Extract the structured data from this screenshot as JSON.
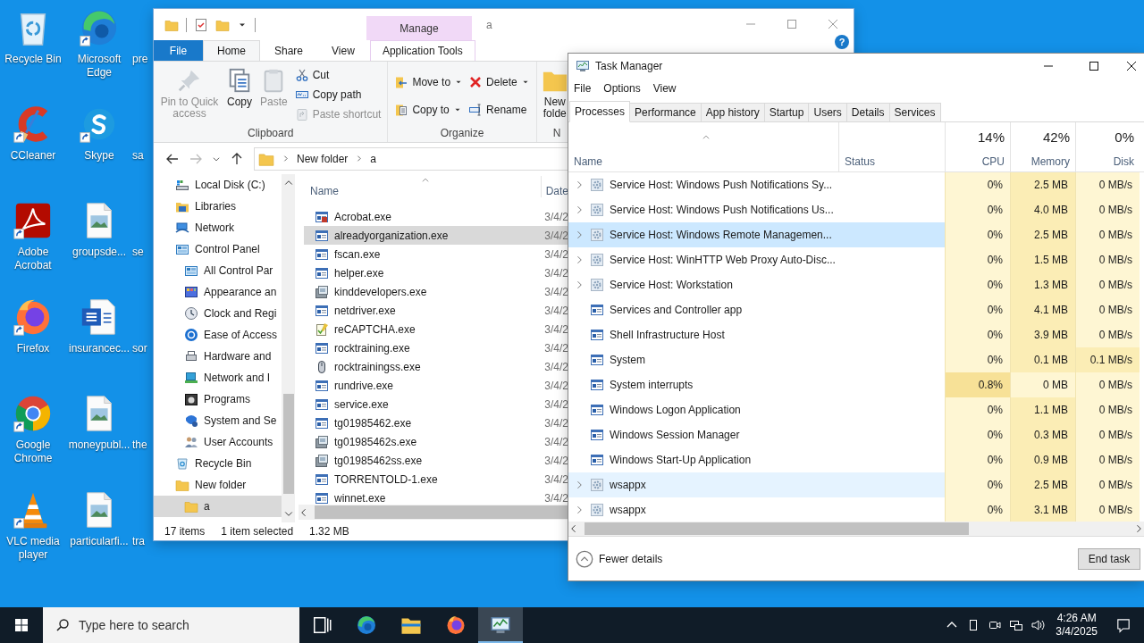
{
  "desktop": {
    "icons": [
      {
        "label": "Recycle Bin",
        "kind": "recycle",
        "shortcut": false
      },
      {
        "label": "Microsoft Edge",
        "kind": "edge",
        "shortcut": true
      },
      {
        "label": "pre",
        "kind": "partial"
      },
      {
        "label": "CCleaner",
        "kind": "ccleaner",
        "shortcut": true
      },
      {
        "label": "Skype",
        "kind": "skype",
        "shortcut": true
      },
      {
        "label": "sa",
        "kind": "partial"
      },
      {
        "label": "Adobe Acrobat",
        "kind": "acrobat",
        "shortcut": true
      },
      {
        "label": "groupsde...",
        "kind": "image",
        "shortcut": false
      },
      {
        "label": "se",
        "kind": "partial"
      },
      {
        "label": "Firefox",
        "kind": "firefox",
        "shortcut": true
      },
      {
        "label": "insurancec...",
        "kind": "word",
        "shortcut": false
      },
      {
        "label": "sor",
        "kind": "partial"
      },
      {
        "label": "Google Chrome",
        "kind": "chrome",
        "shortcut": true
      },
      {
        "label": "moneypubl...",
        "kind": "image",
        "shortcut": false
      },
      {
        "label": "the",
        "kind": "partial"
      },
      {
        "label": "VLC media player",
        "kind": "vlc",
        "shortcut": true
      },
      {
        "label": "particularfi...",
        "kind": "image",
        "shortcut": false
      },
      {
        "label": "tra",
        "kind": "partial"
      }
    ]
  },
  "explorer": {
    "title": "a",
    "context_header": "Manage",
    "help": "?",
    "tabs": [
      {
        "label": "File",
        "kind": "file",
        "selected": false
      },
      {
        "label": "Home",
        "kind": "plain",
        "selected": true
      },
      {
        "label": "Share",
        "kind": "plain",
        "selected": false
      },
      {
        "label": "View",
        "kind": "plain",
        "selected": false
      },
      {
        "label": "Application Tools",
        "kind": "context",
        "selected": false
      }
    ],
    "ribbon": [
      {
        "label": "Clipboard",
        "columns": [
          [
            {
              "label": "Pin to Quick access",
              "kind": "pin",
              "disabled": true
            }
          ],
          [
            {
              "label": "Copy",
              "kind": "copy",
              "disabled": false
            }
          ],
          [
            {
              "label": "Paste",
              "kind": "paste",
              "disabled": true
            }
          ],
          [
            {
              "label": "Cut",
              "kind": "cut",
              "disabled": false
            },
            {
              "label": "Copy path",
              "kind": "path",
              "disabled": false
            },
            {
              "label": "Paste shortcut",
              "kind": "shortcut",
              "disabled": true
            }
          ]
        ]
      },
      {
        "label": "Organize",
        "columns": [
          [
            {
              "label": "Move to",
              "kind": "move",
              "disabled": false,
              "dropdown": true
            },
            {
              "label": "Copy to",
              "kind": "copyto",
              "disabled": false,
              "dropdown": true
            }
          ],
          [
            {
              "label": "Delete",
              "kind": "delete",
              "disabled": false,
              "dropdown": true
            },
            {
              "label": "Rename",
              "kind": "rename",
              "disabled": false,
              "dropdown": false
            }
          ]
        ]
      },
      {
        "label": "N",
        "columns": [
          [
            {
              "label": "New folde",
              "kind": "newfolder",
              "disabled": false
            }
          ]
        ]
      }
    ],
    "address": {
      "crumbs": [
        "New folder",
        "a"
      ]
    },
    "nav": [
      {
        "label": "Local Disk (C:)",
        "kind": "drive",
        "selected": false
      },
      {
        "label": "Libraries",
        "kind": "library",
        "selected": false
      },
      {
        "label": "Network",
        "kind": "network",
        "selected": false
      },
      {
        "label": "Control Panel",
        "kind": "panel",
        "selected": false,
        "children": [
          {
            "label": "All Control Par",
            "kind": "panel",
            "selected": false
          },
          {
            "label": "Appearance an",
            "kind": "appearance",
            "selected": false
          },
          {
            "label": "Clock and Regi",
            "kind": "clock",
            "selected": false
          },
          {
            "label": "Ease of Access",
            "kind": "ease",
            "selected": false
          },
          {
            "label": "Hardware and",
            "kind": "hardware",
            "selected": false
          },
          {
            "label": "Network and I",
            "kind": "netcenter",
            "selected": false
          },
          {
            "label": "Programs",
            "kind": "programs",
            "selected": false
          },
          {
            "label": "System and Se",
            "kind": "security",
            "selected": false
          },
          {
            "label": "User Accounts",
            "kind": "users",
            "selected": false
          }
        ]
      },
      {
        "label": "Recycle Bin",
        "kind": "recycle",
        "selected": false
      },
      {
        "label": "New folder",
        "kind": "folder",
        "selected": false,
        "children": [
          {
            "label": "a",
            "kind": "folder",
            "selected": true
          }
        ]
      }
    ],
    "columns": [
      "Name",
      "Date"
    ],
    "files": [
      {
        "name": "Acrobat.exe",
        "kind": "acrofile",
        "date": "3/4/2",
        "selected": false
      },
      {
        "name": "alreadyorganization.exe",
        "kind": "exe",
        "date": "3/4/2",
        "selected": true
      },
      {
        "name": "fscan.exe",
        "kind": "exe",
        "date": "3/4/2",
        "selected": false
      },
      {
        "name": "helper.exe",
        "kind": "exe",
        "date": "3/4/2",
        "selected": false
      },
      {
        "name": "kinddevelopers.exe",
        "kind": "setup",
        "date": "3/4/2",
        "selected": false
      },
      {
        "name": "netdriver.exe",
        "kind": "exe",
        "date": "3/4/2",
        "selected": false
      },
      {
        "name": "reCAPTCHA.exe",
        "kind": "note",
        "date": "3/4/2",
        "selected": false
      },
      {
        "name": "rocktraining.exe",
        "kind": "exe",
        "date": "3/4/2",
        "selected": false
      },
      {
        "name": "rocktrainingss.exe",
        "kind": "capsule",
        "date": "3/4/2",
        "selected": false
      },
      {
        "name": "rundrive.exe",
        "kind": "exe",
        "date": "3/4/2",
        "selected": false
      },
      {
        "name": "service.exe",
        "kind": "exe",
        "date": "3/4/2",
        "selected": false
      },
      {
        "name": "tg01985462.exe",
        "kind": "exe",
        "date": "3/4/2",
        "selected": false
      },
      {
        "name": "tg01985462s.exe",
        "kind": "setup",
        "date": "3/4/2",
        "selected": false
      },
      {
        "name": "tg01985462ss.exe",
        "kind": "setup",
        "date": "3/4/2",
        "selected": false
      },
      {
        "name": "TORRENTOLD-1.exe",
        "kind": "exe",
        "date": "3/4/2",
        "selected": false
      },
      {
        "name": "winnet.exe",
        "kind": "exe",
        "date": "3/4/2",
        "selected": false
      }
    ],
    "status": {
      "count": "17 items",
      "selection": "1 item selected",
      "size": "1.32 MB"
    }
  },
  "task_manager": {
    "title": "Task Manager",
    "menu": [
      "File",
      "Options",
      "View"
    ],
    "tabs": [
      {
        "label": "Processes",
        "selected": true
      },
      {
        "label": "Performance",
        "selected": false
      },
      {
        "label": "App history",
        "selected": false
      },
      {
        "label": "Startup",
        "selected": false
      },
      {
        "label": "Users",
        "selected": false
      },
      {
        "label": "Details",
        "selected": false
      },
      {
        "label": "Services",
        "selected": false
      }
    ],
    "columns": [
      {
        "label": "Name",
        "kind": "name"
      },
      {
        "label": "Status",
        "kind": "status"
      },
      {
        "label": "CPU",
        "total": "14%",
        "kind": "metric"
      },
      {
        "label": "Memory",
        "total": "42%",
        "kind": "metric"
      },
      {
        "label": "Disk",
        "total": "0%",
        "kind": "metric"
      }
    ],
    "rows": [
      {
        "expandable": true,
        "selected": false,
        "hovered": false,
        "cells": [
          {
            "text": "Service Host: Windows Push Notifications Sy..."
          },
          {
            "text": ""
          },
          {
            "text": "0%",
            "color": "#fef6d3"
          },
          {
            "text": "2.5 MB",
            "color": "#fbedb5"
          },
          {
            "text": "0 MB/s",
            "color": "#fef6d3"
          }
        ]
      },
      {
        "expandable": true,
        "selected": false,
        "hovered": false,
        "cells": [
          {
            "text": "Service Host: Windows Push Notifications Us..."
          },
          {
            "text": ""
          },
          {
            "text": "0%",
            "color": "#fef6d3"
          },
          {
            "text": "4.0 MB",
            "color": "#fbedb5"
          },
          {
            "text": "0 MB/s",
            "color": "#fef6d3"
          }
        ]
      },
      {
        "expandable": true,
        "selected": true,
        "hovered": false,
        "cells": [
          {
            "text": "Service Host: Windows Remote Managemen..."
          },
          {
            "text": ""
          },
          {
            "text": "0%",
            "color": "#fef6d3"
          },
          {
            "text": "2.5 MB",
            "color": "#fbedb5"
          },
          {
            "text": "0 MB/s",
            "color": "#fef6d3"
          }
        ]
      },
      {
        "expandable": true,
        "selected": false,
        "hovered": false,
        "cells": [
          {
            "text": "Service Host: WinHTTP Web Proxy Auto-Disc..."
          },
          {
            "text": ""
          },
          {
            "text": "0%",
            "color": "#fef6d3"
          },
          {
            "text": "1.5 MB",
            "color": "#fbedb5"
          },
          {
            "text": "0 MB/s",
            "color": "#fef6d3"
          }
        ]
      },
      {
        "expandable": true,
        "selected": false,
        "hovered": false,
        "cells": [
          {
            "text": "Service Host: Workstation"
          },
          {
            "text": ""
          },
          {
            "text": "0%",
            "color": "#fef6d3"
          },
          {
            "text": "1.3 MB",
            "color": "#fbedb5"
          },
          {
            "text": "0 MB/s",
            "color": "#fef6d3"
          }
        ]
      },
      {
        "expandable": false,
        "selected": false,
        "hovered": false,
        "cells": [
          {
            "text": "Services and Controller app"
          },
          {
            "text": ""
          },
          {
            "text": "0%",
            "color": "#fef6d3"
          },
          {
            "text": "4.1 MB",
            "color": "#fbedb5"
          },
          {
            "text": "0 MB/s",
            "color": "#fef6d3"
          }
        ]
      },
      {
        "expandable": false,
        "selected": false,
        "hovered": false,
        "cells": [
          {
            "text": "Shell Infrastructure Host"
          },
          {
            "text": ""
          },
          {
            "text": "0%",
            "color": "#fef6d3"
          },
          {
            "text": "3.9 MB",
            "color": "#fbedb5"
          },
          {
            "text": "0 MB/s",
            "color": "#fef6d3"
          }
        ]
      },
      {
        "expandable": false,
        "selected": false,
        "hovered": false,
        "cells": [
          {
            "text": "System"
          },
          {
            "text": ""
          },
          {
            "text": "0%",
            "color": "#fef6d3"
          },
          {
            "text": "0.1 MB",
            "color": "#fbedb5"
          },
          {
            "text": "0.1 MB/s",
            "color": "#fbedb5"
          }
        ]
      },
      {
        "expandable": false,
        "selected": false,
        "hovered": false,
        "cells": [
          {
            "text": "System interrupts"
          },
          {
            "text": ""
          },
          {
            "text": "0.8%",
            "color": "#f7e197"
          },
          {
            "text": "0 MB",
            "color": "#fef6d3"
          },
          {
            "text": "0 MB/s",
            "color": "#fef6d3"
          }
        ]
      },
      {
        "expandable": false,
        "selected": false,
        "hovered": false,
        "cells": [
          {
            "text": "Windows Logon Application"
          },
          {
            "text": ""
          },
          {
            "text": "0%",
            "color": "#fef6d3"
          },
          {
            "text": "1.1 MB",
            "color": "#fbedb5"
          },
          {
            "text": "0 MB/s",
            "color": "#fef6d3"
          }
        ]
      },
      {
        "expandable": false,
        "selected": false,
        "hovered": false,
        "cells": [
          {
            "text": "Windows Session Manager"
          },
          {
            "text": ""
          },
          {
            "text": "0%",
            "color": "#fef6d3"
          },
          {
            "text": "0.3 MB",
            "color": "#fbedb5"
          },
          {
            "text": "0 MB/s",
            "color": "#fef6d3"
          }
        ]
      },
      {
        "expandable": false,
        "selected": false,
        "hovered": false,
        "cells": [
          {
            "text": "Windows Start-Up Application"
          },
          {
            "text": ""
          },
          {
            "text": "0%",
            "color": "#fef6d3"
          },
          {
            "text": "0.9 MB",
            "color": "#fbedb5"
          },
          {
            "text": "0 MB/s",
            "color": "#fef6d3"
          }
        ]
      },
      {
        "expandable": true,
        "selected": false,
        "hovered": true,
        "cells": [
          {
            "text": "wsappx"
          },
          {
            "text": ""
          },
          {
            "text": "0%",
            "color": "#fef6d3"
          },
          {
            "text": "2.5 MB",
            "color": "#fbedb5"
          },
          {
            "text": "0 MB/s",
            "color": "#fef6d3"
          }
        ]
      },
      {
        "expandable": true,
        "selected": false,
        "hovered": false,
        "cells": [
          {
            "text": "wsappx"
          },
          {
            "text": ""
          },
          {
            "text": "0%",
            "color": "#fef6d3"
          },
          {
            "text": "3.1 MB",
            "color": "#fbedb5"
          },
          {
            "text": "0 MB/s",
            "color": "#fef6d3"
          }
        ]
      }
    ],
    "footer": {
      "fewer": "Fewer details",
      "end_task": "End task"
    }
  },
  "taskbar": {
    "search_placeholder": "Type here to search",
    "apps": [
      {
        "kind": "taskview",
        "active": false
      },
      {
        "kind": "edge",
        "active": false
      },
      {
        "kind": "explorer",
        "active": false
      },
      {
        "kind": "firefox",
        "active": false
      },
      {
        "kind": "taskmanager",
        "active": true
      }
    ],
    "time": "4:26 AM",
    "date": "3/4/2025"
  }
}
